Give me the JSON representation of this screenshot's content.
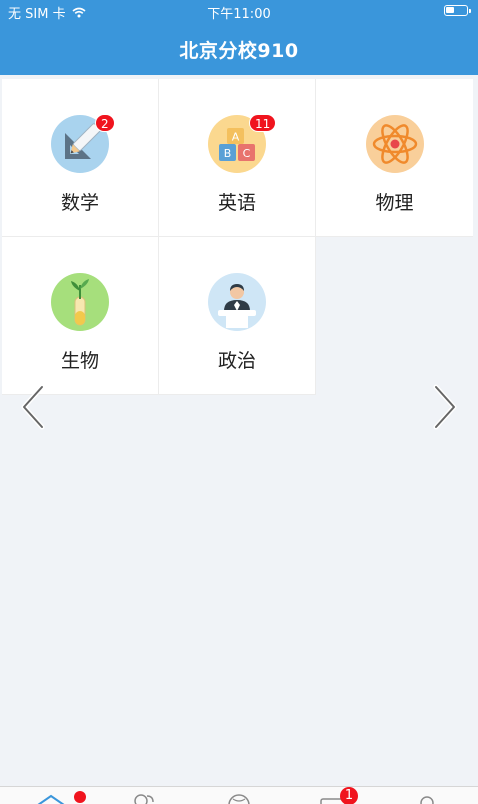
{
  "status_bar": {
    "carrier": "无 SIM 卡",
    "time": "下午11:00"
  },
  "header": {
    "title": "北京分校910"
  },
  "subjects": [
    {
      "label": "数学",
      "icon": "ruler-pencil-icon",
      "badge": "2"
    },
    {
      "label": "英语",
      "icon": "abc-blocks-icon",
      "badge": "11"
    },
    {
      "label": "物理",
      "icon": "atom-icon",
      "badge": ""
    },
    {
      "label": "生物",
      "icon": "test-tube-plant-icon",
      "badge": ""
    },
    {
      "label": "政治",
      "icon": "speaker-podium-icon",
      "badge": ""
    }
  ],
  "tabbar": {
    "tabs": [
      "home-icon",
      "people-icon",
      "globe-icon",
      "message-icon",
      "profile-icon"
    ],
    "message_badge": "1"
  },
  "colors": {
    "accent": "#3a96db",
    "badge": "#f0141e",
    "background": "#f0f3f7"
  }
}
